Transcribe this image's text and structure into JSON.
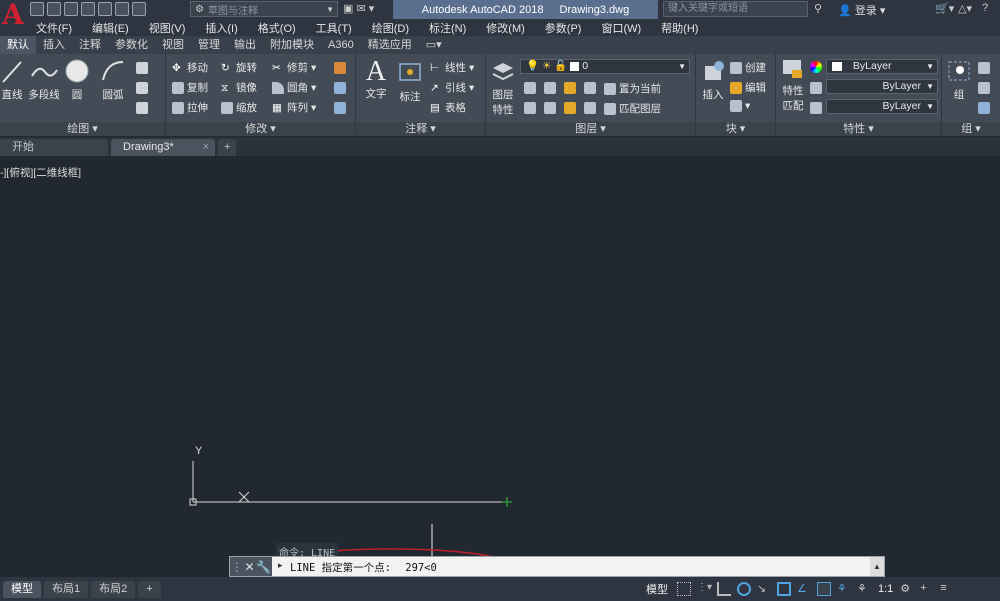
{
  "app": {
    "logo": "A",
    "name": "Autodesk AutoCAD 2018",
    "file": "Drawing3.dwg"
  },
  "titlebar": {
    "workspace": "草图与注释",
    "search_placeholder": "键入关键字或短语",
    "login": "登录"
  },
  "menu": [
    "文件(F)",
    "编辑(E)",
    "视图(V)",
    "插入(I)",
    "格式(O)",
    "工具(T)",
    "绘图(D)",
    "标注(N)",
    "修改(M)",
    "参数(P)",
    "窗口(W)",
    "帮助(H)"
  ],
  "ribbon_tabs": [
    "默认",
    "插入",
    "注释",
    "参数化",
    "视图",
    "管理",
    "输出",
    "附加模块",
    "A360",
    "精选应用"
  ],
  "ribbon": {
    "draw": {
      "title": "绘图 ▾",
      "line": "直线",
      "polyline": "多段线",
      "circle": "圆",
      "arc": "圆弧"
    },
    "modify": {
      "title": "修改 ▾",
      "move": "移动",
      "rotate": "旋转",
      "trim": "修剪",
      "copy": "复制",
      "mirror": "镜像",
      "fillet": "圆角",
      "stretch": "拉伸",
      "scale": "缩放",
      "array": "阵列"
    },
    "annotation": {
      "title": "注释 ▾",
      "text": "文字",
      "dimension": "标注",
      "linear": "线性",
      "leader": "引线",
      "table": "表格"
    },
    "layers": {
      "title": "图层 ▾",
      "properties_line1": "图层",
      "properties_line2": "特性",
      "current_layer": "0",
      "set_current": "置为当前",
      "match_layer": "匹配图层"
    },
    "block": {
      "title": "块 ▾",
      "insert": "插入",
      "create": "创建",
      "edit": "编辑"
    },
    "properties": {
      "title": "特性 ▾",
      "match_line1": "特性",
      "match_line2": "匹配",
      "color": "ByLayer",
      "linetype": "ByLayer",
      "lineweight": "ByLayer"
    },
    "groups": {
      "title": "组 ▾",
      "group": "组"
    }
  },
  "doc_tabs": [
    "开始",
    "Drawing3*"
  ],
  "viewport": {
    "label": "-][俯视][二维线框]",
    "ucs_y": "Y",
    "ucs_x": "X"
  },
  "command": {
    "history": "命令: LINE",
    "prompt": "LINE 指定第一个点:",
    "input": "297<0"
  },
  "status": {
    "layout_tabs": [
      "模型",
      "布局1",
      "布局2"
    ],
    "model_label": "模型",
    "scale": "1:1"
  },
  "colors": {
    "accent_red": "#d2212e",
    "ucs_green": "#2fbf3c",
    "annotation_circle": "#c0202a"
  }
}
